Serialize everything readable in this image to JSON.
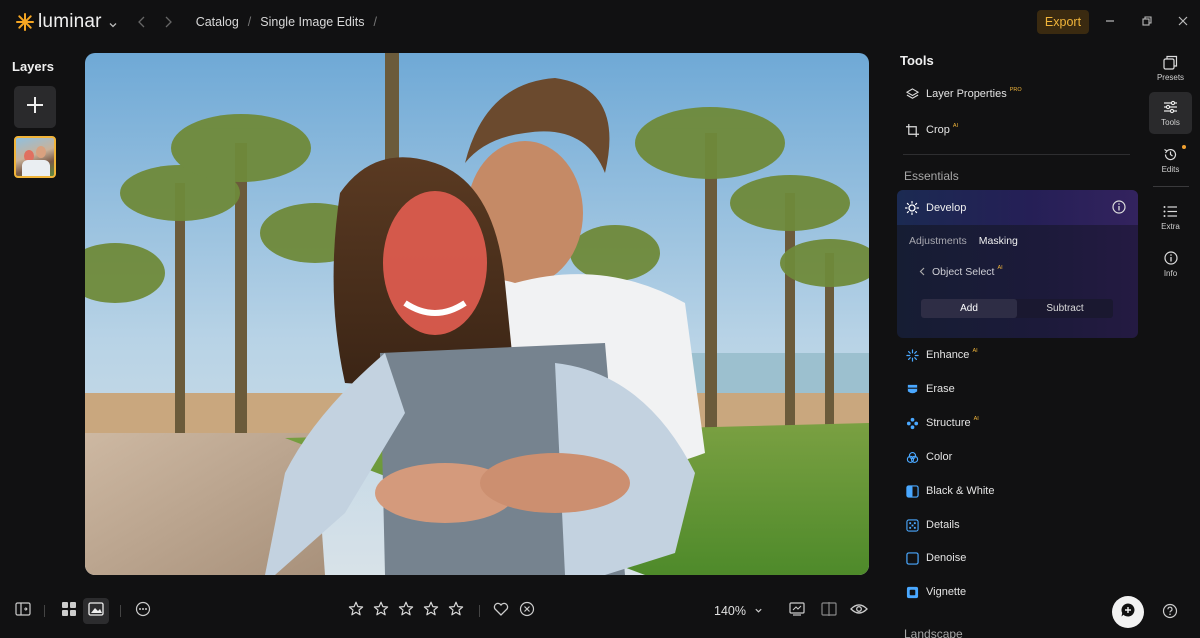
{
  "app": {
    "name": "luminar",
    "accent": "#f0b43a"
  },
  "titlebar": {
    "breadcrumbs": [
      "Catalog",
      "Single Image Edits"
    ],
    "trailing_sep": "/",
    "export_label": "Export"
  },
  "layers": {
    "title": "Layers",
    "add_icon": "plus-icon"
  },
  "bottombar": {
    "zoom": "140%",
    "rating_stars": 0,
    "star_count": 5
  },
  "tools": {
    "title": "Tools",
    "top_items": [
      {
        "label": "Layer Properties",
        "badge": "PRO",
        "icon": "layers-icon"
      },
      {
        "label": "Crop",
        "badge": "AI",
        "icon": "crop-icon"
      }
    ],
    "section_essentials": "Essentials",
    "develop": {
      "label": "Develop",
      "tabs": [
        "Adjustments",
        "Masking"
      ],
      "active_tab": "Masking",
      "object_select": "Object Select",
      "object_select_badge": "AI",
      "segments": [
        "Add",
        "Subtract"
      ],
      "active_segment": "Add"
    },
    "items": [
      {
        "label": "Enhance",
        "badge": "AI",
        "icon": "enhance-icon",
        "color": "#4aa8ff"
      },
      {
        "label": "Erase",
        "badge": "",
        "icon": "erase-icon",
        "color": "#4aa8ff"
      },
      {
        "label": "Structure",
        "badge": "AI",
        "icon": "structure-icon",
        "color": "#4aa8ff"
      },
      {
        "label": "Color",
        "badge": "",
        "icon": "color-icon",
        "color": "#4aa8ff"
      },
      {
        "label": "Black & White",
        "badge": "",
        "icon": "black-white-icon",
        "color": "#4aa8ff"
      },
      {
        "label": "Details",
        "badge": "",
        "icon": "details-icon",
        "color": "#4aa8ff"
      },
      {
        "label": "Denoise",
        "badge": "",
        "icon": "denoise-icon",
        "color": "#4aa8ff"
      },
      {
        "label": "Vignette",
        "badge": "",
        "icon": "vignette-icon",
        "color": "#4aa8ff"
      }
    ],
    "section_landscape": "Landscape"
  },
  "rail": {
    "items": [
      "Presets",
      "Tools",
      "Edits",
      "Extra",
      "Info"
    ],
    "active": "Tools"
  }
}
